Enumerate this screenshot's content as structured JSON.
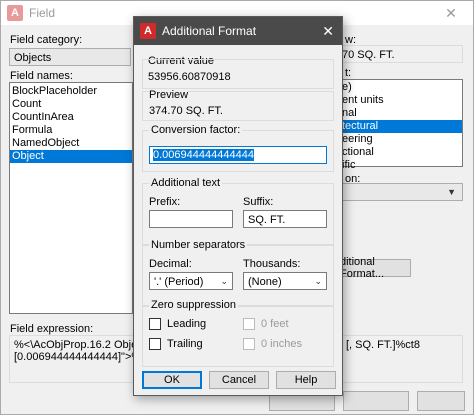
{
  "background_window": {
    "title": "Field",
    "field_category_label": "Field category:",
    "field_category_value": "Objects",
    "field_names_label": "Field names:",
    "field_names": [
      "BlockPlaceholder",
      "Count",
      "CountInArea",
      "Formula",
      "NamedObject",
      "Object"
    ],
    "selected_field_name": "Object",
    "right_label_1": "w:",
    "right_value_1": "70 SQ. FT.",
    "right_label_2": "t:",
    "right_list": [
      "e)",
      "ent units",
      "nal",
      "tectural",
      "eering",
      "ctional",
      "ific"
    ],
    "right_list_selected": "tectural",
    "right_label_3": "on:",
    "additional_format_button": "ditional Format...",
    "field_expression_label": "Field expression:",
    "field_expression_text_1": "%<\\AcObjProp.16.2 Object(%",
    "field_expression_text_2": "[0.006944444444444]\">%",
    "field_expression_right": "[, SQ. FT.]%ct8",
    "bottom_btn_1": "",
    "bottom_btn_2": "",
    "bottom_btn_3": ""
  },
  "dialog": {
    "title": "Additional Format",
    "current_value_label": "Current value",
    "current_value": "53956.60870918",
    "preview_label": "Preview",
    "preview_value": "374.70 SQ. FT.",
    "conversion_factor_label": "Conversion factor:",
    "conversion_factor_value": "0.006944444444444",
    "additional_text_label": "Additional text",
    "prefix_label": "Prefix:",
    "prefix_value": "",
    "suffix_label": "Suffix:",
    "suffix_value": "SQ. FT.",
    "number_separators_label": "Number separators",
    "decimal_label": "Decimal:",
    "decimal_value": "'.' (Period)",
    "thousands_label": "Thousands:",
    "thousands_value": "(None)",
    "zero_suppression_label": "Zero suppression",
    "leading_label": "Leading",
    "zero_feet_label": "0 feet",
    "trailing_label": "Trailing",
    "zero_inches_label": "0 inches",
    "ok_label": "OK",
    "cancel_label": "Cancel",
    "help_label": "Help"
  }
}
